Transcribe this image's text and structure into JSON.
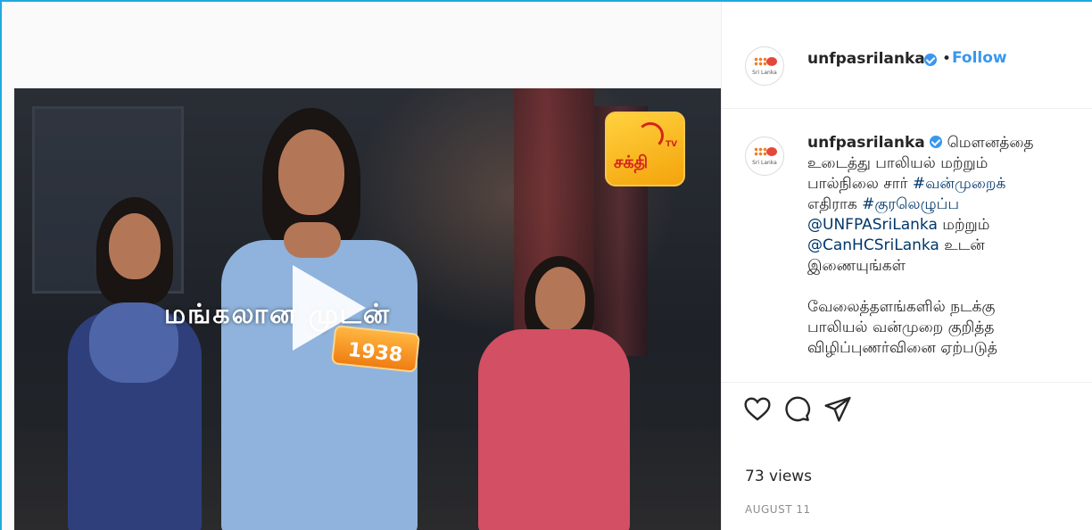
{
  "post": {
    "username": "unfpasrilanka",
    "dot": "•",
    "follow_label": "Follow",
    "avatar_caption": "Sri Lanka",
    "caption_lines": [
      "மௌனத்தை",
      "உடைத்து பாலியல் மற்றும்",
      "பால்நிலை சார் ",
      "எதிராக ",
      "@UNFPASriLanka",
      " மற்றும்",
      "@CanHCSriLanka",
      " உடன்",
      "இணையுங்கள்",
      "வேலைத்தளங்களில் நடக்கு",
      "பாலியல் வன்முறை குறித்த",
      "விழிப்புணர்வினை ஏற்படுத்"
    ],
    "hashtags": [
      "#வன்முறைக்",
      "#குரலெழுப்ப"
    ],
    "views": "73 views",
    "date": "AUGUST 11"
  },
  "video": {
    "overlay_text": "மங்கலான முடன்",
    "phone_number": "1938",
    "channel_logo_text": "சக்தி",
    "channel_logo_tv": "TV"
  },
  "icons": {
    "like": "heart-icon",
    "comment": "comment-icon",
    "share": "paper-plane-icon",
    "play": "play-icon",
    "verified": "verified-badge-icon"
  },
  "colors": {
    "accent": "#3897f0",
    "frame_border": "#1fa8e0",
    "text": "#262626",
    "muted": "#8e8e8e"
  }
}
